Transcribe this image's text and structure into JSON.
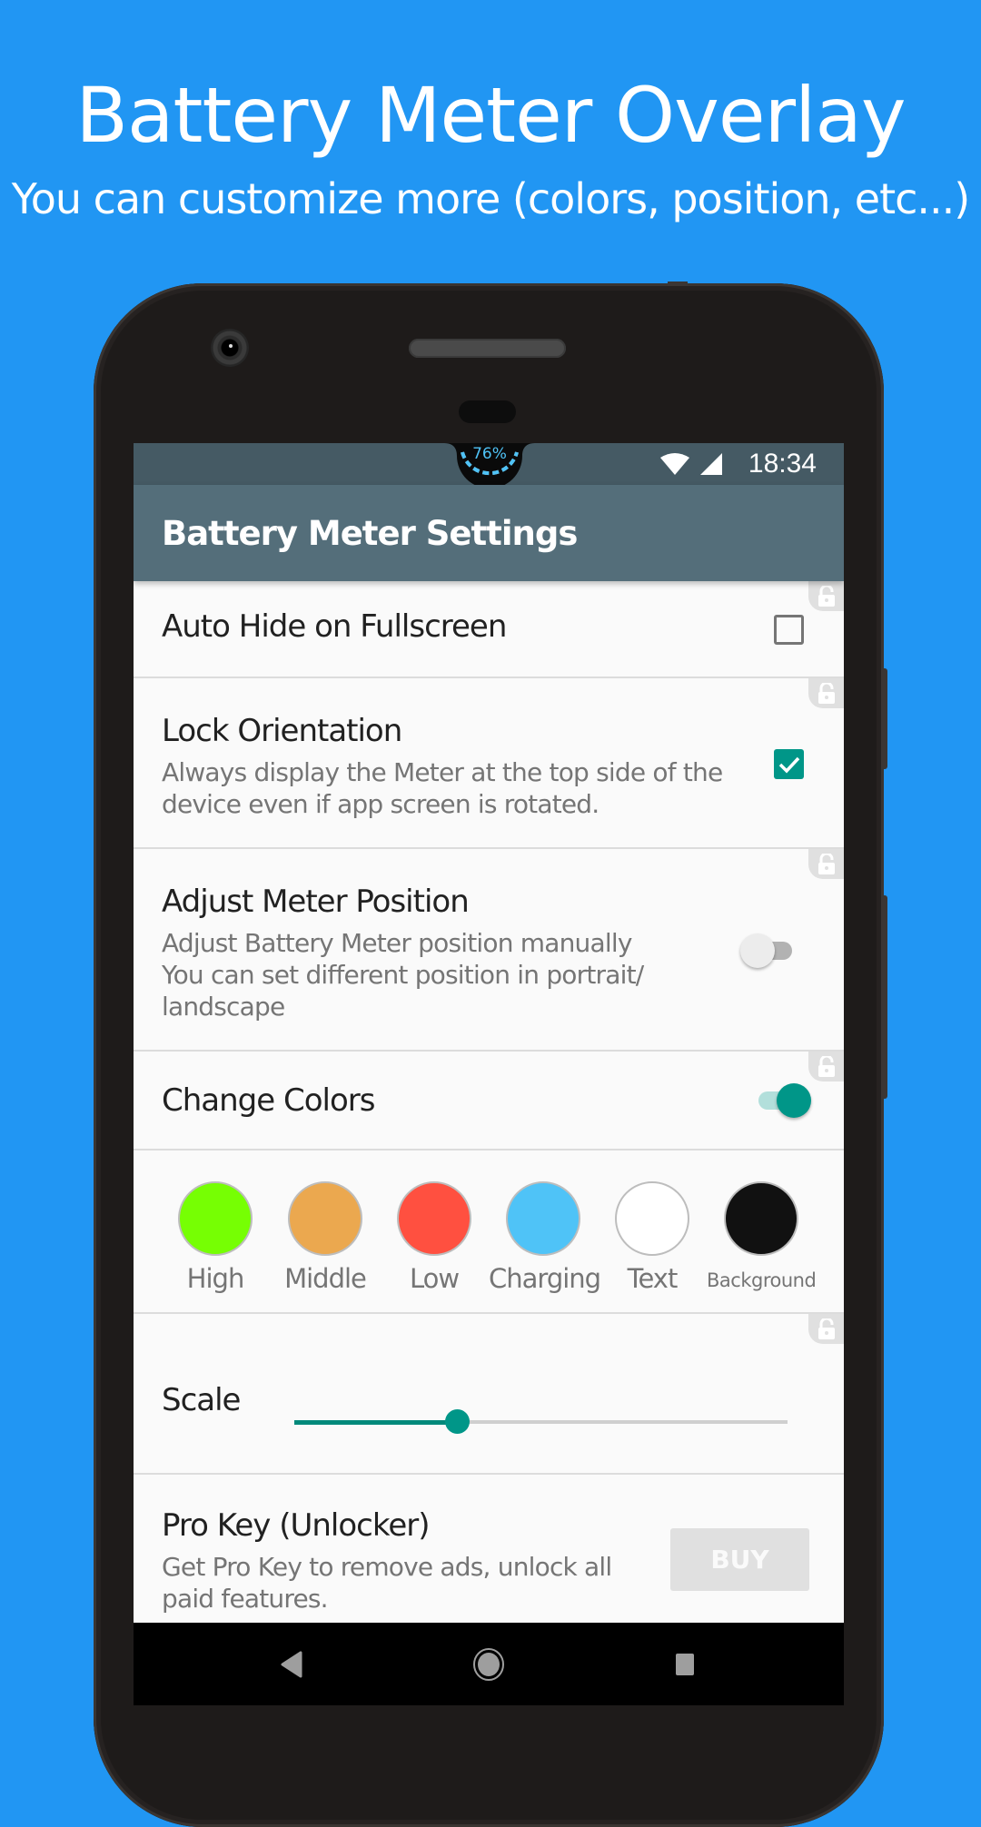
{
  "promo": {
    "title": "Battery Meter Overlay",
    "subtitle": "You can customize more (colors, position, etc...)"
  },
  "status_bar": {
    "battery_percent_label": "76%",
    "battery_level": 0.76,
    "time": "18:34",
    "icons": [
      "wifi-icon",
      "cell-signal-icon"
    ]
  },
  "toolbar": {
    "title": "Battery Meter Settings"
  },
  "settings": {
    "auto_hide": {
      "title": "Auto Hide on Fullscreen",
      "checked": false,
      "locked": true
    },
    "lock_orientation": {
      "title": "Lock Orientation",
      "summary_line1": "Always display the Meter at the top side of the",
      "summary_line2": "device even if app screen is rotated.",
      "checked": true,
      "locked": true
    },
    "adjust_position": {
      "title": "Adjust Meter Position",
      "summary_line1": "Adjust Battery Meter position manually",
      "summary_line2": "You can set different position in portrait/",
      "summary_line3": "landscape",
      "enabled": false,
      "locked": true
    },
    "change_colors": {
      "title": "Change Colors",
      "enabled": true,
      "locked": true
    },
    "colors": [
      {
        "label": "High",
        "color": "#76ff03"
      },
      {
        "label": "Middle",
        "color": "#eba84f"
      },
      {
        "label": "Low",
        "color": "#ff5040"
      },
      {
        "label": "Charging",
        "color": "#4fc3f7"
      },
      {
        "label": "Text",
        "color": "#ffffff"
      },
      {
        "label": "Background",
        "color": "#111111"
      }
    ],
    "scale": {
      "title": "Scale",
      "value_fraction": 0.33,
      "locked": true
    },
    "pro_key": {
      "title": "Pro Key (Unlocker)",
      "summary_line1": "Get Pro Key to remove ads, unlock all",
      "summary_line2": "paid features.",
      "button_label": "BUY"
    }
  },
  "theme": {
    "accent": "#009688",
    "status_bar": "#455a64",
    "toolbar": "#546e7a",
    "background": "#2196f3"
  }
}
